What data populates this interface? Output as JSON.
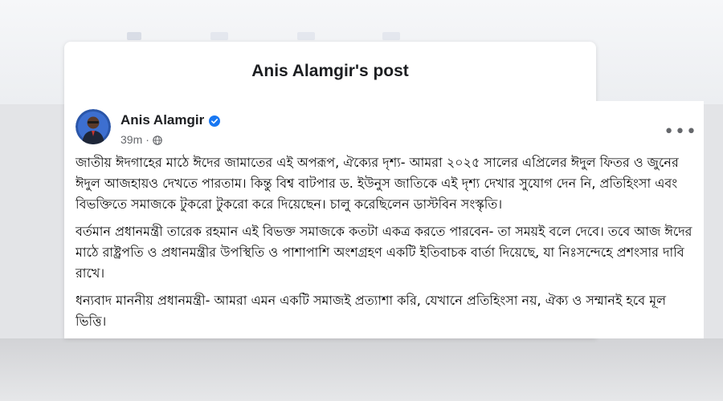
{
  "modal": {
    "title": "Anis Alamgir's post"
  },
  "post": {
    "author": "Anis Alamgir",
    "time": "39m",
    "more_icon": "more-options-icon",
    "verified_icon": "verified-badge-icon",
    "audience_icon": "globe-icon",
    "paragraphs": [
      "জাতীয় ঈদগাহের মাঠে ঈদের জামাতের এই অপরূপ, ঐক্যের দৃশ্য- আমরা ২০২৫ সালের এপ্রিলের ঈদুল ফিতর ও জুনের ঈদুল আজহায়ও দেখতে পারতাম। কিন্তু বিশ্ব বাটপার ড. ইউনুস জাতিকে এই দৃশ্য দেখার সুযোগ দেন নি, প্রতিহিংসা এবং বিভক্তিতে সমাজকে টুকরো টুকরো করে দিয়েছেন। চালু করেছিলেন ডাস্টবিন সংস্কৃতি।",
      "বর্তমান প্রধানমন্ত্রী তারেক রহমান এই বিভক্ত সমাজকে কতটা একত্র করতে পারবেন- তা সময়ই বলে দেবে। তবে আজ ঈদের মাঠে রাষ্ট্রপতি ও প্রধানমন্ত্রীর উপস্থিতি ও পাশাপাশি অংশগ্রহণ একটি ইতিবাচক বার্তা দিয়েছে, যা নিঃসন্দেহে প্রশংসার দাবি রাখে।",
      "ধন্যবাদ মাননীয় প্রধানমন্ত্রী- আমরা এমন একটি সমাজই প্রত্যাশা করি, যেখানে প্রতিহিংসা নয়, ঐক্য ও সম্মানই হবে মূল ভিত্তি।"
    ]
  },
  "colors": {
    "verified": "#1877f2",
    "text": "#050505",
    "muted": "#65676b"
  }
}
